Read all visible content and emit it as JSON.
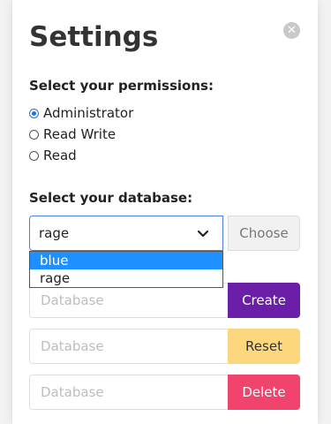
{
  "title": "Settings",
  "close_icon": "close-icon",
  "permissions": {
    "label": "Select your permissions:",
    "options": [
      "Administrator",
      "Read Write",
      "Read"
    ],
    "selected": "Administrator"
  },
  "database": {
    "label": "Select your database:",
    "selected": "rage",
    "options": [
      "blue",
      "rage"
    ],
    "highlighted": "blue",
    "choose_label": "Choose"
  },
  "actions": [
    {
      "placeholder": "Database",
      "button": "Create",
      "color": "#6b1fa8"
    },
    {
      "placeholder": "Database",
      "button": "Reset",
      "color": "#fdd77d"
    },
    {
      "placeholder": "Database",
      "button": "Delete",
      "color": "#f0446d"
    }
  ]
}
